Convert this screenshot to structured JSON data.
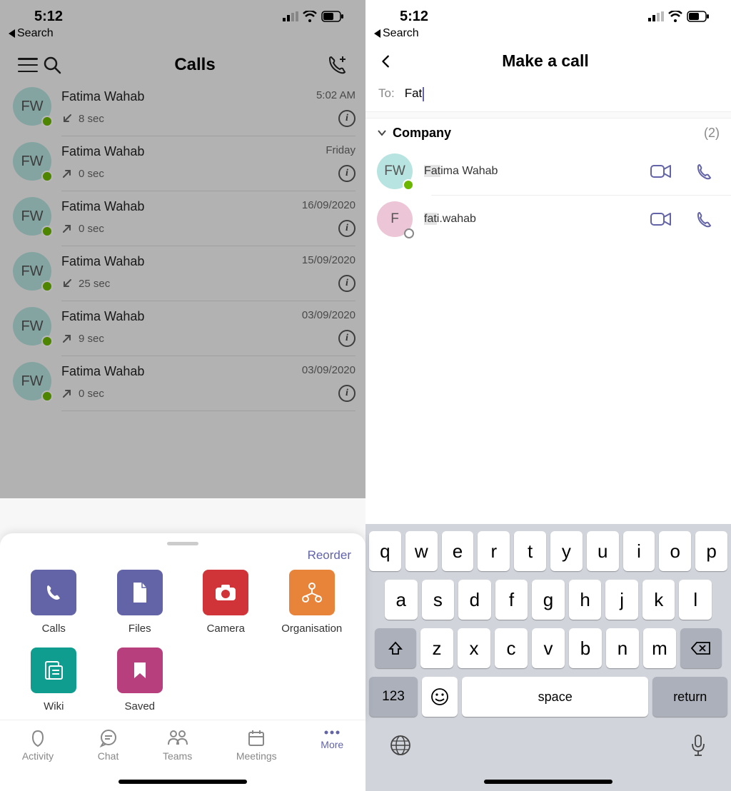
{
  "status": {
    "time": "5:12",
    "back": "Search"
  },
  "left": {
    "title": "Calls",
    "calls": [
      {
        "avatar": "FW",
        "name": "Fatima Wahab",
        "time": "5:02 AM",
        "dir": "in",
        "dur": "8 sec"
      },
      {
        "avatar": "FW",
        "name": "Fatima Wahab",
        "time": "Friday",
        "dir": "out",
        "dur": "0 sec"
      },
      {
        "avatar": "FW",
        "name": "Fatima Wahab",
        "time": "16/09/2020",
        "dir": "out",
        "dur": "0 sec"
      },
      {
        "avatar": "FW",
        "name": "Fatima Wahab",
        "time": "15/09/2020",
        "dir": "in",
        "dur": "25 sec"
      },
      {
        "avatar": "FW",
        "name": "Fatima Wahab",
        "time": "03/09/2020",
        "dir": "out",
        "dur": "9 sec"
      },
      {
        "avatar": "FW",
        "name": "Fatima Wahab",
        "time": "03/09/2020",
        "dir": "out",
        "dur": "0 sec"
      }
    ],
    "sheet": {
      "reorder": "Reorder",
      "items": [
        {
          "label": "Calls",
          "color": "#6264a7",
          "icon": "phone"
        },
        {
          "label": "Files",
          "color": "#6264a7",
          "icon": "file"
        },
        {
          "label": "Camera",
          "color": "#d13438",
          "icon": "camera"
        },
        {
          "label": "Organisation",
          "color": "#e8833a",
          "icon": "org"
        },
        {
          "label": "Wiki",
          "color": "#0f9d8f",
          "icon": "wiki"
        },
        {
          "label": "Saved",
          "color": "#b83f7d",
          "icon": "bookmark"
        }
      ]
    },
    "tabs": [
      {
        "label": "Activity"
      },
      {
        "label": "Chat"
      },
      {
        "label": "Teams"
      },
      {
        "label": "Meetings"
      },
      {
        "label": "More",
        "active": true
      }
    ]
  },
  "right": {
    "title": "Make a call",
    "to_label": "To:",
    "to_value": "Fat",
    "group": {
      "name": "Company",
      "count": "(2)"
    },
    "results": [
      {
        "avatar": "FW",
        "avclass": "av-teal",
        "name_hl": "Fat",
        "name_rest": "ima Wahab",
        "online": true
      },
      {
        "avatar": "F",
        "avclass": "av-pink",
        "name_hl": "fat",
        "name_rest": "i.wahab",
        "online": false
      }
    ],
    "keyboard": {
      "row1": [
        "q",
        "w",
        "e",
        "r",
        "t",
        "y",
        "u",
        "i",
        "o",
        "p"
      ],
      "row2": [
        "a",
        "s",
        "d",
        "f",
        "g",
        "h",
        "j",
        "k",
        "l"
      ],
      "row3": [
        "z",
        "x",
        "c",
        "v",
        "b",
        "n",
        "m"
      ],
      "k123": "123",
      "space": "space",
      "ret": "return"
    }
  }
}
